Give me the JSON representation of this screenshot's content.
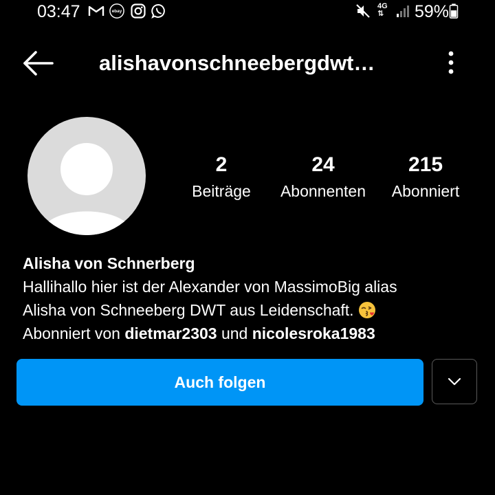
{
  "status_bar": {
    "time": "03:47",
    "network": "4G",
    "battery": "59%",
    "icons": [
      "gmail-icon",
      "ebay-icon",
      "instagram-icon",
      "whatsapp-icon",
      "mute-icon",
      "signal-icon",
      "battery-icon"
    ]
  },
  "header": {
    "username": "alishavonschneebergdwt…",
    "back_icon": "arrow-left-icon",
    "menu_icon": "more-vertical-icon"
  },
  "profile": {
    "avatar": "default-avatar",
    "stats": [
      {
        "value": "2",
        "label": "Beiträge"
      },
      {
        "value": "24",
        "label": "Abonnenten"
      },
      {
        "value": "215",
        "label": "Abonniert"
      }
    ],
    "name": "Alisha von Schnerberg",
    "bio_line1": "Hallihallo hier ist der Alexander von MassimoBig alias",
    "bio_line2": "Alisha von Schneeberg DWT aus Leidenschaft.",
    "followed_by_prefix": "Abonniert von ",
    "followed_by_user1": "dietmar2303",
    "followed_by_and": " und ",
    "followed_by_user2": "nicolesroka1983"
  },
  "actions": {
    "follow_label": "Auch folgen",
    "dropdown_icon": "chevron-down-icon"
  },
  "colors": {
    "background": "#000000",
    "accent": "#0095f6",
    "text": "#ffffff",
    "avatar_bg": "#dbdbdb"
  }
}
